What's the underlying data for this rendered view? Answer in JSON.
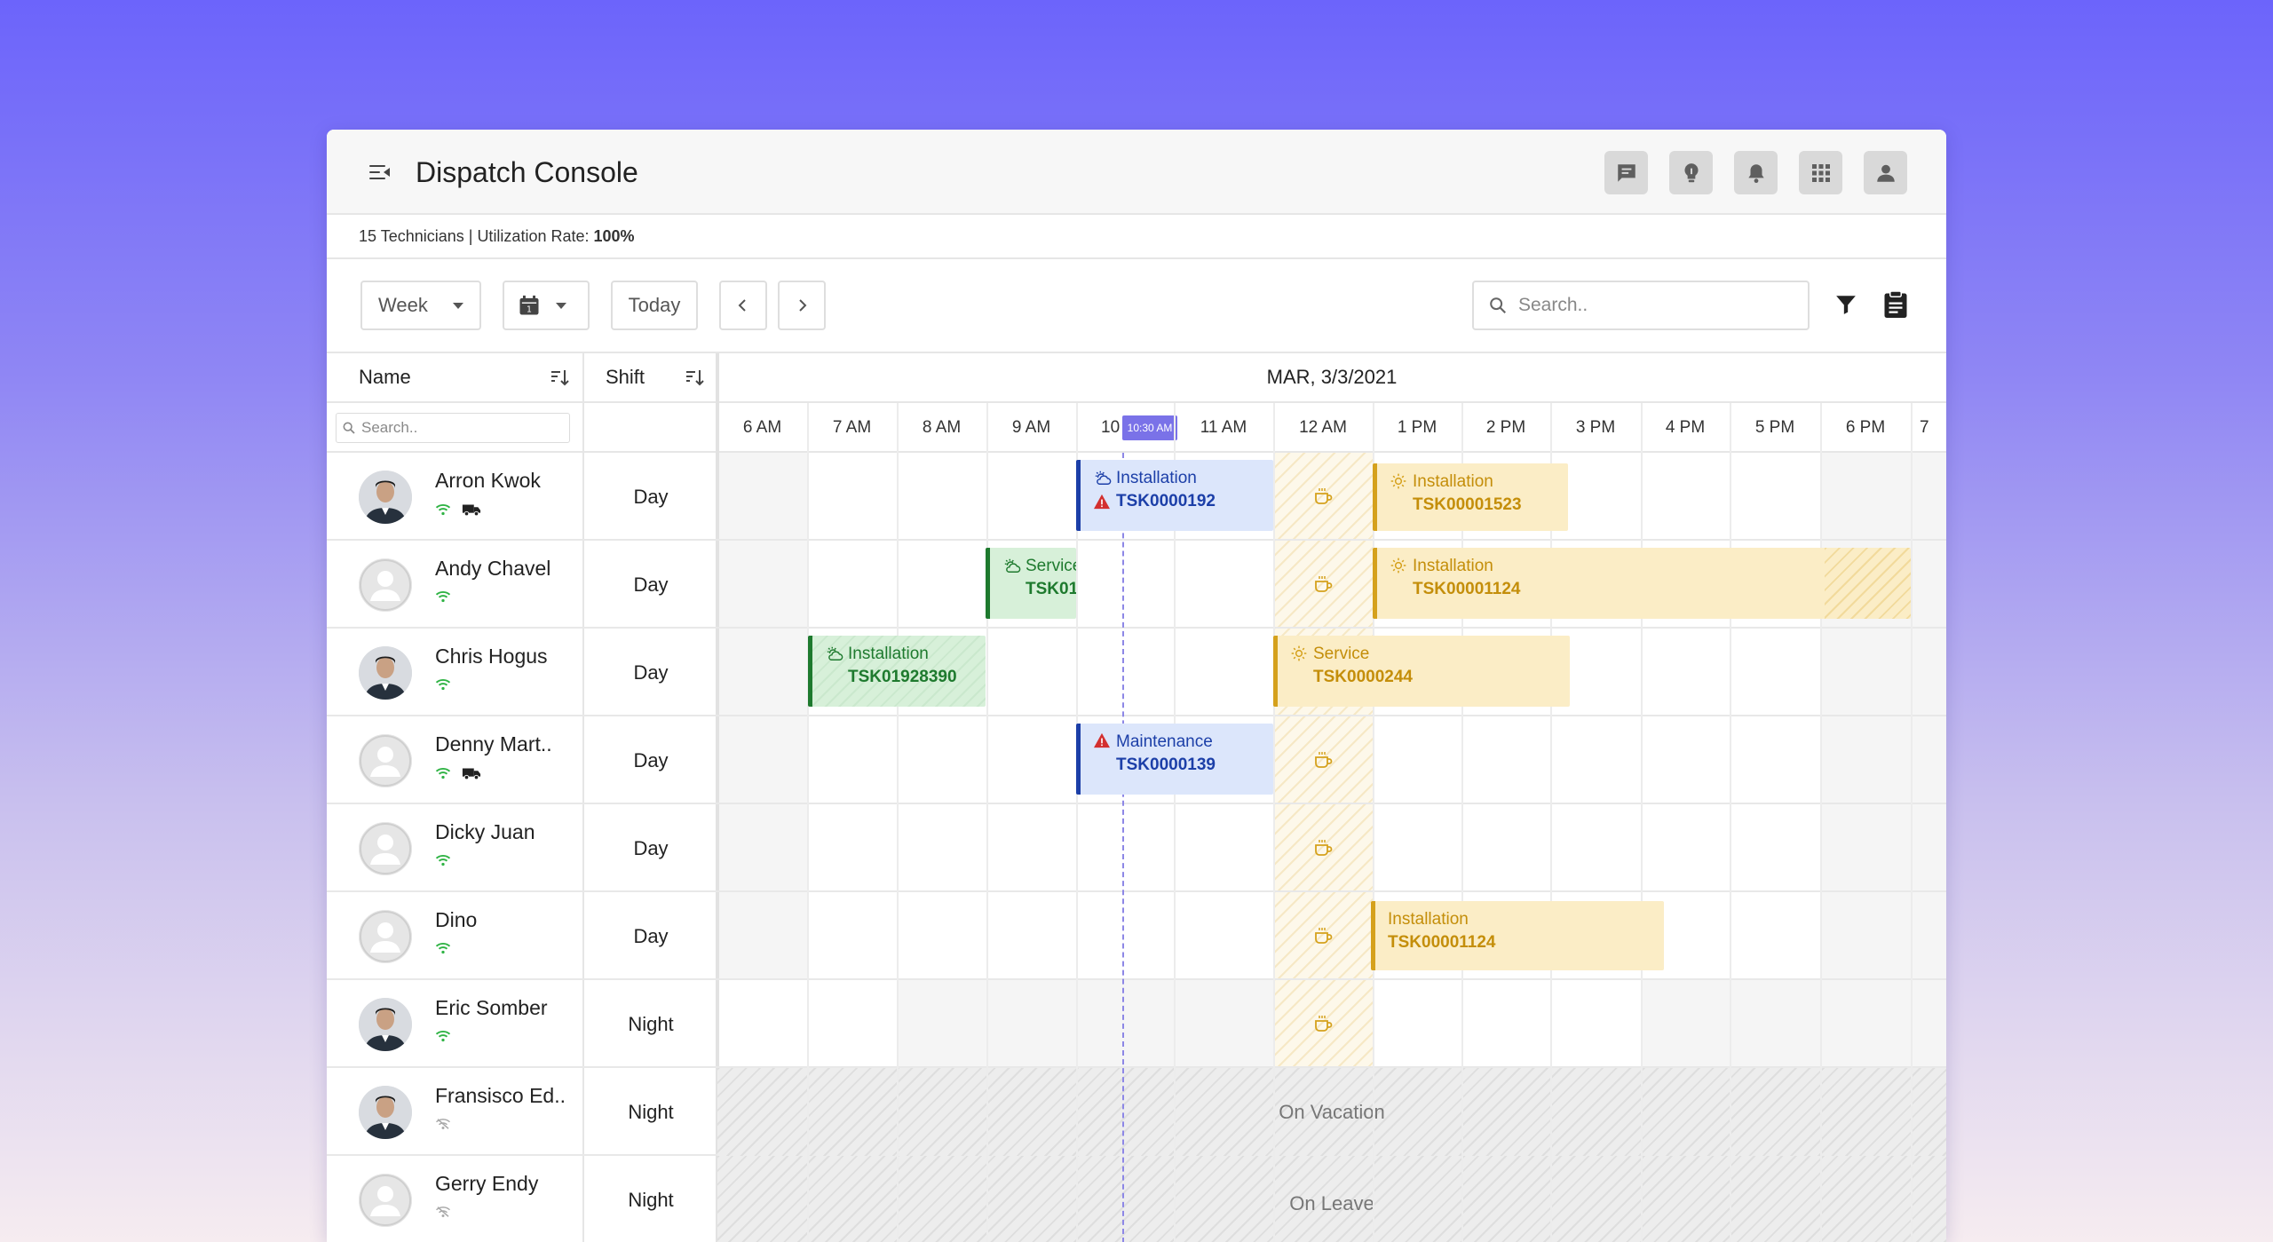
{
  "app": {
    "title": "Dispatch Console"
  },
  "header_icons": [
    "message-icon",
    "lightbulb-icon",
    "bell-icon",
    "apps-grid-icon",
    "user-icon"
  ],
  "summary": {
    "technicians": "15 Technicians",
    "separator": " | ",
    "utilization_label": "Utilization Rate: ",
    "utilization_value": "100%"
  },
  "toolbar": {
    "view": "Week",
    "today": "Today",
    "calendar_day": "1",
    "search_placeholder": "Search.."
  },
  "columns": {
    "name": "Name",
    "shift": "Shift",
    "name_search_placeholder": "Search.."
  },
  "date_header": "MAR, 3/3/2021",
  "times": [
    "6 AM",
    "7 AM",
    "8 AM",
    "9 AM",
    "10",
    "11 AM",
    "12 AM",
    "1 PM",
    "2 PM",
    "3 PM",
    "4 PM",
    "5 PM",
    "6 PM",
    "7"
  ],
  "now_marker": "10:30 AM",
  "technicians": [
    {
      "name": "Arron Kwok",
      "shift": "Day",
      "avatar": "photo",
      "online": true,
      "vehicle": true
    },
    {
      "name": "Andy Chavel",
      "shift": "Day",
      "avatar": "placeholder",
      "online": true,
      "vehicle": false
    },
    {
      "name": "Chris Hogus",
      "shift": "Day",
      "avatar": "photo",
      "online": true,
      "vehicle": false
    },
    {
      "name": "Denny Mart..",
      "shift": "Day",
      "avatar": "placeholder",
      "online": true,
      "vehicle": true
    },
    {
      "name": "Dicky Juan",
      "shift": "Day",
      "avatar": "placeholder",
      "online": true,
      "vehicle": false
    },
    {
      "name": "Dino",
      "shift": "Day",
      "avatar": "placeholder",
      "online": true,
      "vehicle": false
    },
    {
      "name": "Eric Somber",
      "shift": "Night",
      "avatar": "photo",
      "online": true,
      "vehicle": false
    },
    {
      "name": "Fransisco Ed..",
      "shift": "Night",
      "avatar": "photo",
      "online": false,
      "vehicle": false
    },
    {
      "name": "Gerry Endy",
      "shift": "Night",
      "avatar": "placeholder",
      "online": false,
      "vehicle": false
    }
  ],
  "tasks": {
    "r0a": {
      "type": "Installation",
      "id": "TSK0000192",
      "color": "blue",
      "icon": "cloud-sun-icon",
      "alert": true
    },
    "r0b": {
      "type": "Installation",
      "id": "TSK00001523",
      "color": "yellow",
      "icon": "sun-icon"
    },
    "r1a": {
      "type": "Service",
      "id": "TSK01",
      "color": "green",
      "icon": "cloud-sun-icon"
    },
    "r1b": {
      "type": "Installation",
      "id": "TSK00001124",
      "color": "yellow",
      "icon": "sun-icon"
    },
    "r2a": {
      "type": "Installation",
      "id": "TSK01928390",
      "color": "green",
      "icon": "cloud-sun-icon"
    },
    "r2b": {
      "type": "Service",
      "id": "TSK0000244",
      "color": "yellow",
      "icon": "sun-icon"
    },
    "r3a": {
      "type": "Maintenance",
      "id": "TSK0000139",
      "color": "blue",
      "alert": true
    },
    "r5a": {
      "type": "Installation",
      "id": "TSK00001124",
      "color": "yellow"
    }
  },
  "absences": {
    "r7": "On Vacation",
    "r8": "On Leave"
  },
  "colors": {
    "accent": "#7a72e8",
    "blue": "#1c3fa8",
    "green": "#1e7a2e",
    "yellow": "#d5a11c",
    "online": "#2fb344"
  }
}
